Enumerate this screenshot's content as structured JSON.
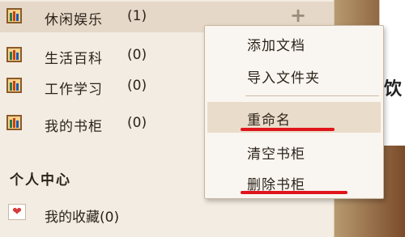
{
  "sidebar": {
    "items": [
      {
        "label": "休闲娱乐",
        "count": "(1)"
      },
      {
        "label": "生活百科",
        "count": "(0)"
      },
      {
        "label": "工作学习",
        "count": "(0)"
      },
      {
        "label": "我的书柜",
        "count": "(0)"
      }
    ],
    "add_symbol": "+",
    "section_title": "个人中心",
    "favorites_label": "我的收藏(0)"
  },
  "context_menu": {
    "items": [
      "添加文档",
      "导入文件夹",
      "重命名",
      "清空书柜",
      "删除书柜"
    ]
  },
  "background": {
    "glyph": "饮"
  },
  "colors": {
    "accent_red": "#e0141b",
    "selected_row": "#e6d8c8"
  }
}
